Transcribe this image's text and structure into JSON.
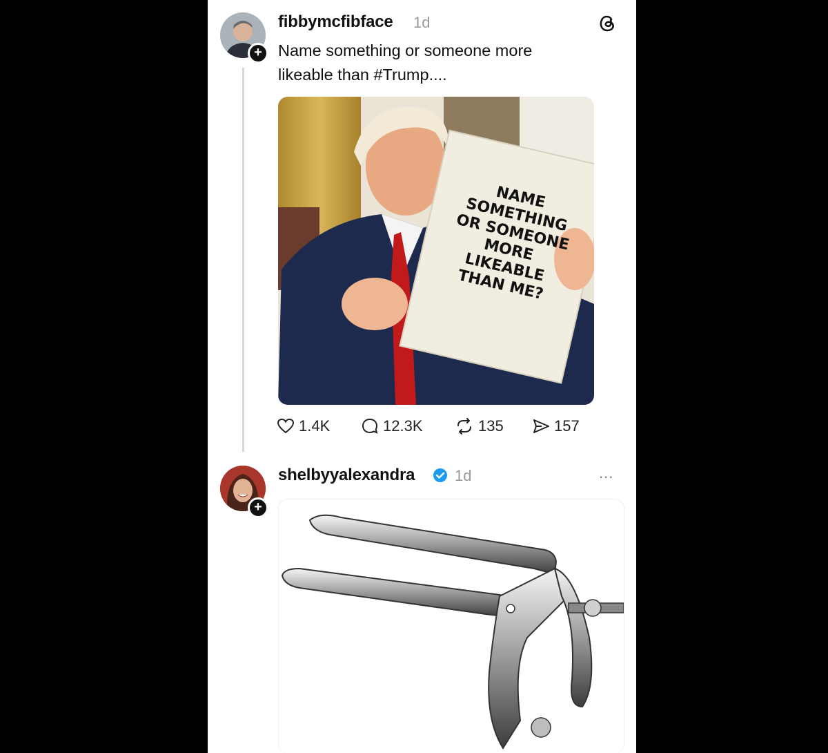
{
  "post": {
    "username": "fibbymcfibface",
    "time": "1d",
    "text_line1": "Name something or someone more",
    "text_line2": "likeable than #Trump....",
    "image_sign": [
      "NAME",
      "SOMETHING",
      "OR SOMEONE",
      "MORE",
      "LIKEABLE",
      "THAN ME?"
    ],
    "likes": "1.4K",
    "replies": "12.3K",
    "reposts": "135",
    "shares": "157"
  },
  "reply": {
    "username": "shelbyyalexandra",
    "time": "1d",
    "verified": true,
    "menu": "..."
  },
  "colors": {
    "verified": "#1d9bf0",
    "plus_badge": "#111111"
  },
  "icons": [
    "threads-logo-icon",
    "heart-icon",
    "comment-icon",
    "repost-icon",
    "share-icon",
    "verified-icon",
    "more-icon"
  ]
}
